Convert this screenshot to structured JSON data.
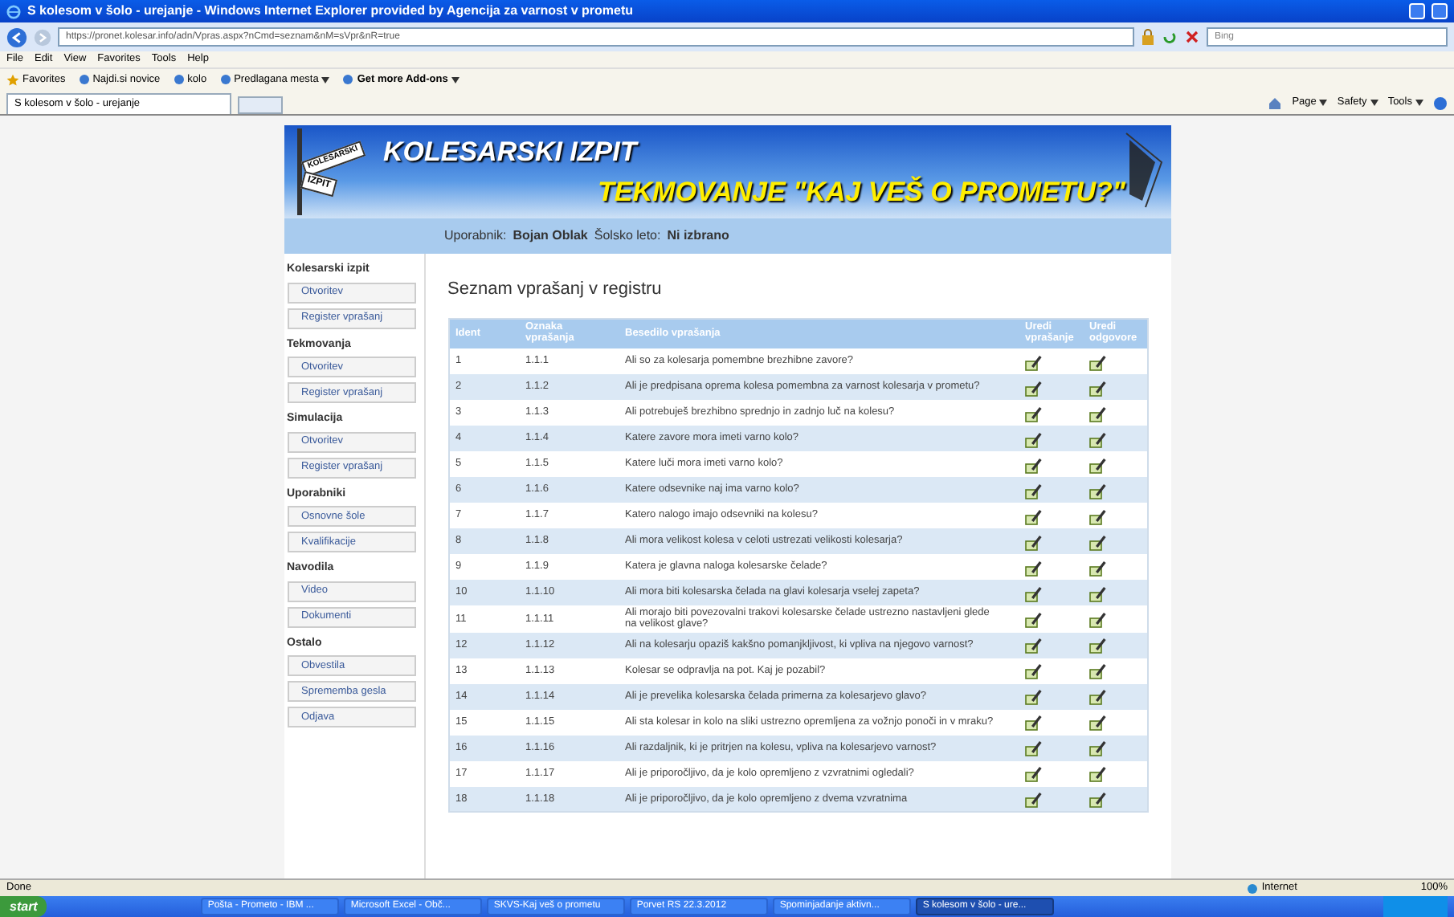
{
  "window": {
    "title": "S kolesom v šolo - urejanje - Windows Internet Explorer provided by Agencija za varnost v prometu"
  },
  "address_bar": {
    "url": "https://pronet.kolesar.info/adn/Vpras.aspx?nCmd=seznam&nM=sVpr&nR=true"
  },
  "search": {
    "placeholder": "Bing"
  },
  "menu": [
    "File",
    "Edit",
    "View",
    "Favorites",
    "Tools",
    "Help"
  ],
  "favorites_bar": {
    "label": "Favorites",
    "links": [
      {
        "label": "Najdi.si novice",
        "dropdown": false,
        "bold": false
      },
      {
        "label": "kolo",
        "dropdown": false,
        "bold": false
      },
      {
        "label": "Predlagana mesta",
        "dropdown": true,
        "bold": false
      },
      {
        "label": "Get more Add-ons",
        "dropdown": true,
        "bold": true
      }
    ]
  },
  "tab": {
    "label": "S kolesom v šolo - urejanje"
  },
  "command_bar": [
    "Page",
    "Safety",
    "Tools"
  ],
  "banner": {
    "sign_top": "KOLESARSKI",
    "sign_bottom": "IZPIT",
    "title": "KOLESARSKI IZPIT",
    "subtitle": "TEKMOVANJE \"KAJ VEŠ O PROMETU?\""
  },
  "user_bar": {
    "user_label": "Uporabnik:",
    "user": "Bojan Oblak",
    "year_label": "Šolsko leto:",
    "year": "Ni izbrano"
  },
  "sidebar": [
    {
      "heading": "Kolesarski izpit",
      "items": [
        "Otvoritev",
        "Register vprašanj"
      ]
    },
    {
      "heading": "Tekmovanja",
      "items": [
        "Otvoritev",
        "Register vprašanj"
      ]
    },
    {
      "heading": "Simulacija",
      "items": [
        "Otvoritev",
        "Register vprašanj"
      ]
    },
    {
      "heading": "Uporabniki",
      "items": [
        "Osnovne šole",
        "Kvalifikacije"
      ]
    },
    {
      "heading": "Navodila",
      "items": [
        "Video",
        "Dokumenti"
      ]
    },
    {
      "heading": "Ostalo",
      "items": [
        "Obvestila",
        "Sprememba gesla",
        "Odjava"
      ]
    }
  ],
  "page_title": "Seznam vprašanj v registru",
  "table": {
    "columns": [
      "Ident",
      "Oznaka vprašanja",
      "Besedilo vprašanja",
      "Uredi vprašanje",
      "Uredi odgovore"
    ],
    "rows": [
      [
        "1",
        "1.1.1",
        "Ali so za kolesarja pomembne brezhibne zavore?"
      ],
      [
        "2",
        "1.1.2",
        "Ali je predpisana oprema kolesa pomembna za varnost kolesarja v prometu?"
      ],
      [
        "3",
        "1.1.3",
        "Ali potrebuješ brezhibno sprednjo in zadnjo luč na kolesu?"
      ],
      [
        "4",
        "1.1.4",
        "Katere zavore mora imeti varno kolo?"
      ],
      [
        "5",
        "1.1.5",
        "Katere luči mora imeti varno kolo?"
      ],
      [
        "6",
        "1.1.6",
        "Katere odsevnike naj ima varno kolo?"
      ],
      [
        "7",
        "1.1.7",
        "Katero nalogo imajo odsevniki na kolesu?"
      ],
      [
        "8",
        "1.1.8",
        "Ali mora velikost kolesa v celoti ustrezati velikosti kolesarja?"
      ],
      [
        "9",
        "1.1.9",
        "Katera je glavna naloga kolesarske čelade?"
      ],
      [
        "10",
        "1.1.10",
        "Ali mora biti kolesarska čelada na glavi kolesarja vselej zapeta?"
      ],
      [
        "11",
        "1.1.11",
        "Ali morajo biti povezovalni trakovi kolesarske čelade ustrezno nastavljeni glede na velikost glave?"
      ],
      [
        "12",
        "1.1.12",
        "Ali na kolesarju opaziš kakšno pomanjkljivost, ki vpliva na njegovo varnost?"
      ],
      [
        "13",
        "1.1.13",
        "Kolesar se odpravlja na pot. Kaj je pozabil?"
      ],
      [
        "14",
        "1.1.14",
        "Ali je prevelika kolesarska čelada primerna za kolesarjevo glavo?"
      ],
      [
        "15",
        "1.1.15",
        "Ali sta kolesar in kolo na sliki ustrezno opremljena za vožnjo ponoči in v mraku?"
      ],
      [
        "16",
        "1.1.16",
        "Ali razdaljnik, ki je pritrjen na kolesu, vpliva na kolesarjevo varnost?"
      ],
      [
        "17",
        "1.1.17",
        "Ali je priporočljivo, da je kolo opremljeno z vzvratnimi ogledali?"
      ],
      [
        "18",
        "1.1.18",
        "Ali je priporočljivo, da je kolo opremljeno z dvema vzvratnima"
      ]
    ]
  },
  "status_bar": {
    "text": "Done",
    "zone": "Internet",
    "zoom": "100%"
  },
  "taskbar": {
    "start": "start",
    "items": [
      {
        "label": "Pošta - Prometo - IBM ...",
        "selected": false
      },
      {
        "label": "Microsoft Excel - Obč...",
        "selected": false
      },
      {
        "label": "SKVS-Kaj veš o prometu",
        "selected": false
      },
      {
        "label": "Porvet RS 22.3.2012",
        "selected": false
      },
      {
        "label": "Spominjadanje aktivn...",
        "selected": false
      },
      {
        "label": "S kolesom v šolo - ure...",
        "selected": true
      }
    ]
  }
}
